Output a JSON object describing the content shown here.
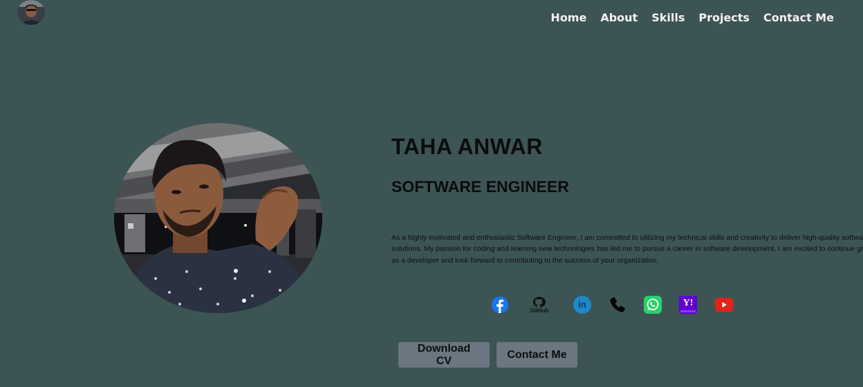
{
  "nav": {
    "links": [
      "Home",
      "About",
      "Skills",
      "Projects",
      "Contact Me"
    ]
  },
  "hero": {
    "name": "TAHA ANWAR",
    "role": "SOFTWARE ENGINEER",
    "bio": "As a highly motivated and enthusiastic Software Engineer, I am committed to utilizing my technical skills and creativity to deliver high-quality software solutions. My passion for coding and learning new technologies has led me to pursue a career in software development. I am excited to continue growing as a developer and look forward to contributing to the success of your organization."
  },
  "socials": {
    "github_label": "GitHub",
    "linkedin_label": "in",
    "yahoo_label": "Y!"
  },
  "buttons": {
    "download_cv": "Download CV",
    "contact_me": "Contact Me"
  },
  "icons": [
    "avatar-photo",
    "facebook-icon",
    "github-icon",
    "linkedin-icon",
    "phone-icon",
    "whatsapp-icon",
    "yahoo-icon",
    "youtube-icon"
  ],
  "colors": {
    "background": "#3d5455",
    "button": "#6b7680",
    "facebook": "#1877f2",
    "linkedin": "#1e88c9",
    "whatsapp": "#25d366",
    "yahoo": "#6001d2",
    "youtube": "#e62117"
  }
}
